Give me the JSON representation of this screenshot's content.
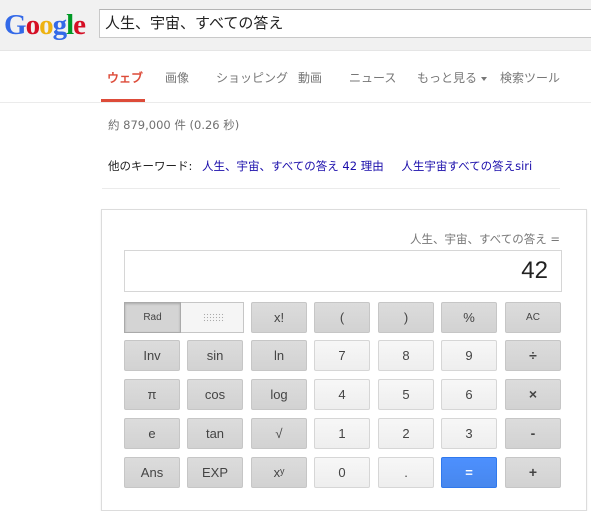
{
  "logo": {
    "letters": [
      "G",
      "o",
      "o",
      "g",
      "l",
      "e"
    ],
    "colors": [
      "#3369e8",
      "#d50f25",
      "#eeb211",
      "#3369e8",
      "#009925",
      "#d50f25"
    ]
  },
  "search": {
    "query": "人生、宇宙、すべての答え"
  },
  "tabs": {
    "web": "ウェブ",
    "images": "画像",
    "shopping": "ショッピング",
    "videos": "動画",
    "news": "ニュース",
    "more": "もっと見る",
    "tools": "検索ツール"
  },
  "stats": "約 879,000 件 (0.26 秒)",
  "related": {
    "label": "他のキーワード:",
    "links": [
      "人生、宇宙、すべての答え 42 理由",
      "人生宇宙すべての答えsiri"
    ]
  },
  "calculator": {
    "expression": "人生、宇宙、すべての答え =",
    "result": "42",
    "rad": "Rad",
    "rows": [
      [
        "x!",
        "(",
        ")",
        "%",
        "AC"
      ],
      [
        "Inv",
        "sin",
        "ln",
        "7",
        "8",
        "9",
        "÷"
      ],
      [
        "π",
        "cos",
        "log",
        "4",
        "5",
        "6",
        "×"
      ],
      [
        "e",
        "tan",
        "√",
        "1",
        "2",
        "3",
        "-"
      ],
      [
        "Ans",
        "EXP",
        "xʸ",
        "0",
        ".",
        "=",
        "+"
      ]
    ]
  },
  "colors": {
    "accent": "#dd4b39",
    "link": "#1a0dab",
    "equals": "#4d90fe"
  }
}
